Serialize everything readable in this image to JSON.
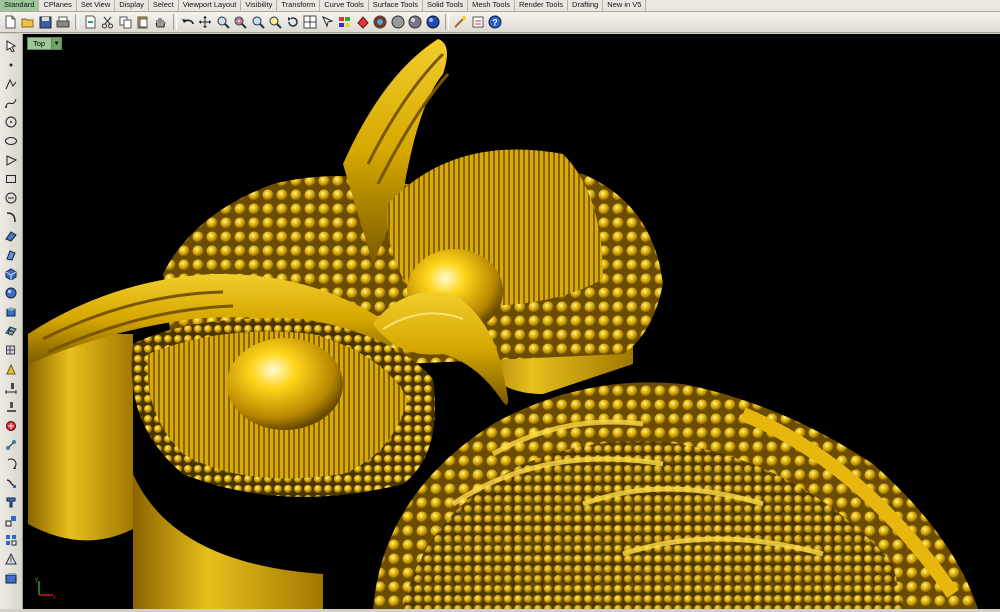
{
  "menu_tabs": [
    {
      "label": "Standard",
      "active": true
    },
    {
      "label": "CPlanes"
    },
    {
      "label": "Set View"
    },
    {
      "label": "Display"
    },
    {
      "label": "Select"
    },
    {
      "label": "Viewport Layout"
    },
    {
      "label": "Visibility"
    },
    {
      "label": "Transform"
    },
    {
      "label": "Curve Tools"
    },
    {
      "label": "Surface Tools"
    },
    {
      "label": "Solid Tools"
    },
    {
      "label": "Mesh Tools"
    },
    {
      "label": "Render Tools"
    },
    {
      "label": "Drafting"
    },
    {
      "label": "New in V5"
    }
  ],
  "viewport": {
    "label": "Top",
    "background": "#000000",
    "model_color": "#d4a800"
  },
  "colors": {
    "active_tab": "#9fc89a",
    "toolbar_bg": "#e9e7df"
  }
}
